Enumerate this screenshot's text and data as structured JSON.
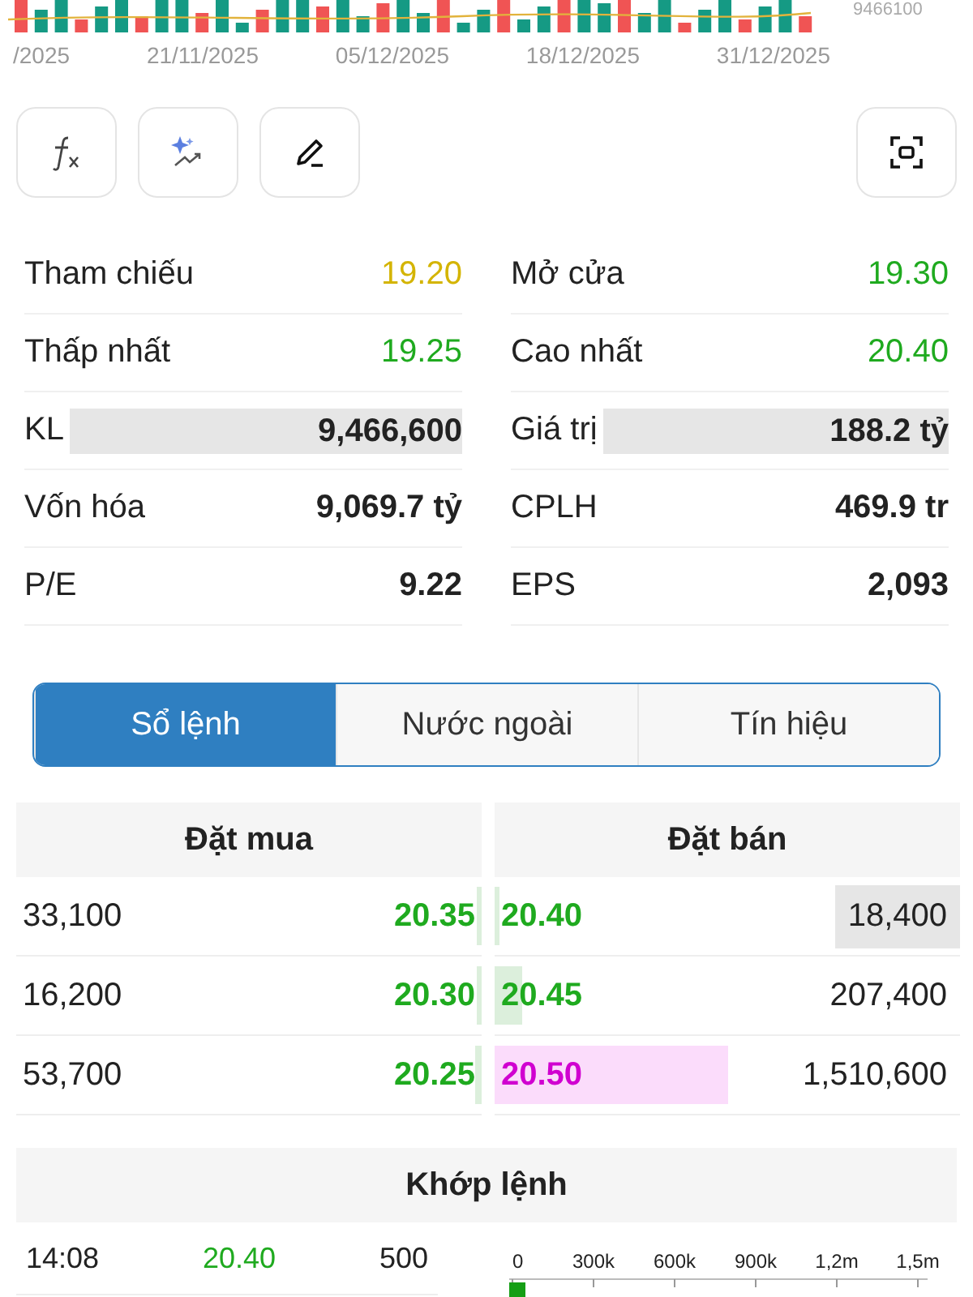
{
  "volume_chart": {
    "max_label": "9466100",
    "date_labels": [
      "/2025",
      "21/11/2025",
      "05/12/2025",
      "18/12/2025",
      "31/12/2025"
    ]
  },
  "tools": [
    {
      "kind": "formula"
    },
    {
      "kind": "ai"
    },
    {
      "kind": "draw"
    },
    {
      "kind": "capture"
    }
  ],
  "stats": [
    {
      "label": "Tham chiếu",
      "value": "19.20",
      "kind": "ref"
    },
    {
      "label": "Mở cửa",
      "value": "19.30",
      "kind": "up"
    },
    {
      "label": "Thấp nhất",
      "value": "19.25",
      "kind": "up"
    },
    {
      "label": "Cao nhất",
      "value": "20.40",
      "kind": "up"
    },
    {
      "label": "KL",
      "value": "9,466,600",
      "kind": "plain",
      "highlighted": true
    },
    {
      "label": "Giá trị",
      "value": "188.2 tỷ",
      "kind": "plain",
      "highlighted": true
    },
    {
      "label": "Vốn hóa",
      "value": "9,069.7 tỷ",
      "kind": "plain"
    },
    {
      "label": "CPLH",
      "value": "469.9 tr",
      "kind": "plain"
    },
    {
      "label": "P/E",
      "value": "9.22",
      "kind": "plain"
    },
    {
      "label": "EPS",
      "value": "2,093",
      "kind": "plain"
    }
  ],
  "tabs": [
    {
      "label": "Sổ lệnh",
      "selected": true
    },
    {
      "label": "Nước ngoài",
      "selected": false
    },
    {
      "label": "Tín hiệu",
      "selected": false
    }
  ],
  "order_book": {
    "buy_title": "Đặt mua",
    "sell_title": "Đặt bán",
    "buy": [
      {
        "volume": "33,100",
        "price": "20.35",
        "kind": "up",
        "level": 0.01
      },
      {
        "volume": "16,200",
        "price": "20.30",
        "kind": "up",
        "level": 0.005
      },
      {
        "volume": "53,700",
        "price": "20.25",
        "kind": "up",
        "level": 0.015
      }
    ],
    "sell": [
      {
        "price": "20.40",
        "kind": "up",
        "level": 0.005,
        "volume": "18,400",
        "highlighted": true
      },
      {
        "price": "20.45",
        "kind": "up",
        "level": 0.06,
        "volume": "207,400",
        "highlighted": false
      },
      {
        "price": "20.50",
        "kind": "ceiling",
        "level": 0.5,
        "volume": "1,510,600",
        "highlighted": false
      }
    ]
  },
  "matches": {
    "title": "Khớp lệnh",
    "rows": [
      {
        "time": "14:08",
        "price": "20.40",
        "kind": "up",
        "volume": "500"
      }
    ],
    "axis_ticks": [
      "0",
      "300k",
      "600k",
      "900k",
      "1,2m",
      "1,5m"
    ]
  }
}
